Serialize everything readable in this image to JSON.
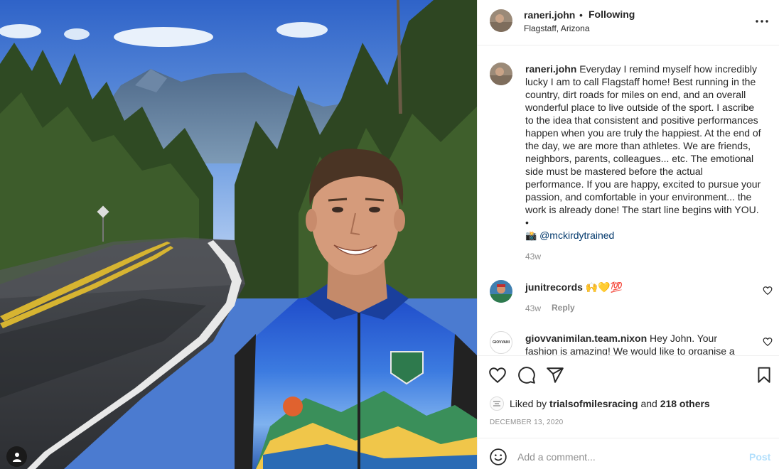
{
  "post": {
    "username": "raneri.john",
    "separator": "•",
    "follow_status": "Following",
    "location": "Flagstaff, Arizona",
    "more_icon": "more-horizontal-icon"
  },
  "caption": {
    "username": "raneri.john",
    "lines": [
      "Everyday I remind myself how incredibly",
      "lucky I am to call Flagstaff home! Best running in the",
      "country, dirt roads for miles on end, and an overall",
      "wonderful place to live outside of the sport. I ascribe",
      "to the idea that consistent and positive performances",
      "happen when you are truly the happiest. At the end of",
      "the day, we are more than athletes. We are friends,",
      "neighbors, parents, colleagues... etc. The emotional",
      "side must be mastered before the actual",
      "performance. If you are happy, excited to pursue your",
      "passion, and comfortable in your environment... the",
      "work is already done! The start line begins with YOU.",
      "•"
    ],
    "camera_emoji": "📸",
    "mention": "@mckirdytrained",
    "time": "43w"
  },
  "comments": [
    {
      "username": "junitrecords",
      "text": "🙌💛💯",
      "time": "43w",
      "reply_label": "Reply"
    },
    {
      "username": "giovvanimilan.team.nixon",
      "text_line1": "Hey John. Your",
      "text_line2": "fashion is amazing! We would like to organise a",
      "avatar_text": "GIOVVANI"
    }
  ],
  "likes": {
    "prefix": "Liked by",
    "user": "trialsofmilesracing",
    "conjunction": "and",
    "others": "218 others"
  },
  "date": "DECEMBER 13, 2020",
  "comment_box": {
    "placeholder": "Add a comment...",
    "post_label": "Post"
  },
  "colors": {
    "link": "#00376b",
    "muted": "#8e8e8e",
    "post_disabled": "#b2dffc",
    "text": "#262626"
  }
}
